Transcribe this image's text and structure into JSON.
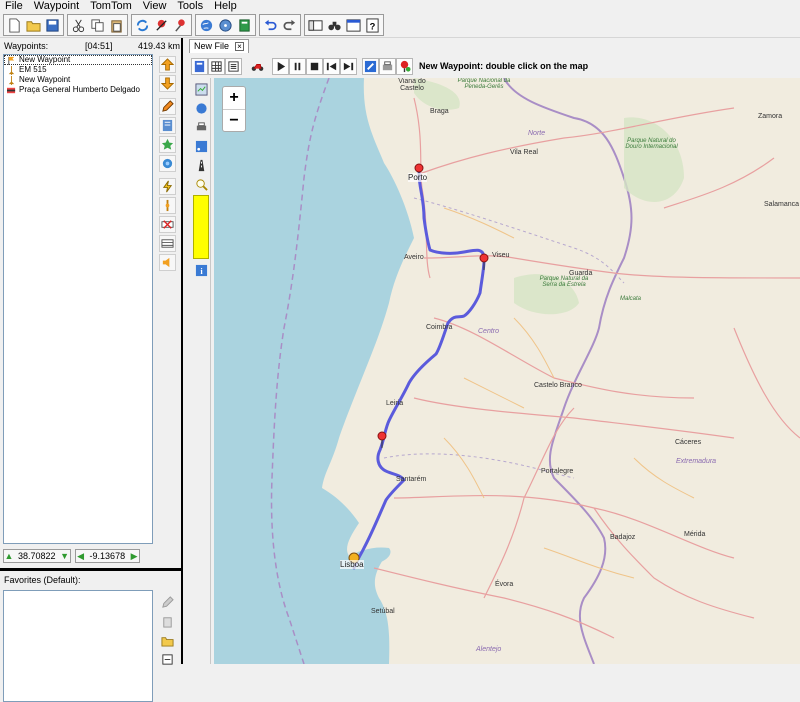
{
  "menu": [
    "File",
    "Waypoint",
    "TomTom",
    "View",
    "Tools",
    "Help"
  ],
  "toolbar_icons": [
    "new-file-icon",
    "open-folder-icon",
    "save-icon",
    "cut-icon",
    "copy-icon",
    "paste-icon",
    "refresh-icon",
    "pin-remove-icon",
    "pin-icon",
    "globe-icon",
    "disk-icon",
    "book-icon",
    "undo-icon",
    "redo-icon",
    "panel-icon",
    "binoculars-icon",
    "window-icon",
    "help-icon"
  ],
  "waypoints_panel": {
    "title": "Waypoints:",
    "time": "[04:51]",
    "distance": "419.43 km",
    "items": [
      {
        "label": "New Waypoint",
        "icon": "start-flag-icon"
      },
      {
        "label": "EM 515",
        "icon": "waypoint-flag-icon"
      },
      {
        "label": "New Waypoint",
        "icon": "waypoint-flag-icon"
      },
      {
        "label": "Praça General Humberto Delgado",
        "icon": "finish-flag-icon"
      }
    ],
    "lat": "38.70822",
    "lon": "-9.13678"
  },
  "favorites": {
    "title": "Favorites (Default):"
  },
  "tab": {
    "label": "New File"
  },
  "map_toolbar": {
    "hint": "New Waypoint: double click on the map"
  },
  "zoom": {
    "in": "+",
    "out": "−"
  },
  "map_labels": [
    {
      "text": "Viana do Castelo"
    },
    {
      "text": "Braga"
    },
    {
      "text": "Porto"
    },
    {
      "text": "Vila Real"
    },
    {
      "text": "Norte"
    },
    {
      "text": "Parque Nacional da Peneda-Gerês"
    },
    {
      "text": "Parque Natural do Douro Internacional"
    },
    {
      "text": "Zamora"
    },
    {
      "text": "Salamanca"
    },
    {
      "text": "Aveiro"
    },
    {
      "text": "Viseu"
    },
    {
      "text": "Guarda"
    },
    {
      "text": "Parque Natural da Serra da Estrela"
    },
    {
      "text": "Malcata"
    },
    {
      "text": "Coimbra"
    },
    {
      "text": "Centro"
    },
    {
      "text": "Castelo Branco"
    },
    {
      "text": "Leiria"
    },
    {
      "text": "Cáceres"
    },
    {
      "text": "Extremadura"
    },
    {
      "text": "Portalegre"
    },
    {
      "text": "Santarém"
    },
    {
      "text": "Badajoz"
    },
    {
      "text": "Mérida"
    },
    {
      "text": "Lisboa"
    },
    {
      "text": "Setúbal"
    },
    {
      "text": "Évora"
    },
    {
      "text": "Alentejo"
    }
  ],
  "colors": {
    "route": "#5b5bdc",
    "sea": "#aad3df",
    "land": "#f1ecdf",
    "yellow_box": "#ffff00"
  }
}
